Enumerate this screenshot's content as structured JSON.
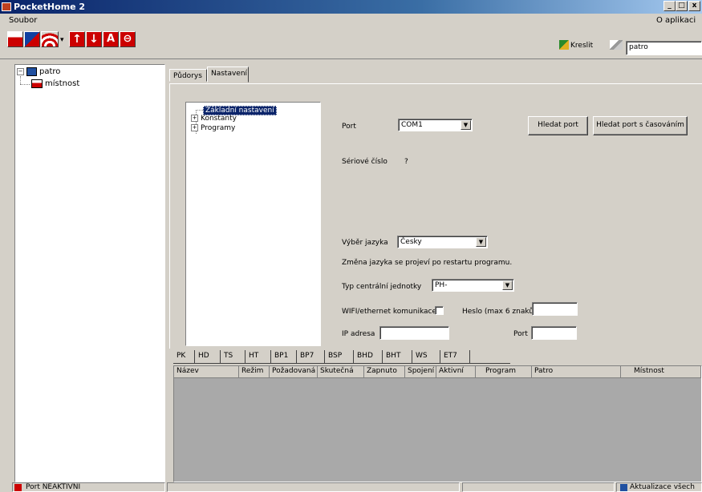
{
  "window": {
    "title": "PocketHome 2",
    "controls": [
      "_",
      "□",
      "x"
    ]
  },
  "menu": {
    "left": "Soubor",
    "right": "O aplikaci"
  },
  "toolbar": {
    "icons": [
      "save-floor-icon",
      "flags-icon",
      "wifi-icon",
      "arrow-up-icon",
      "arrow-down-icon",
      "text-icon",
      "stop-icon"
    ],
    "draw_label": "Kreslit",
    "search_value": "patro"
  },
  "left_tree": {
    "root": "patro",
    "child": "místnost"
  },
  "tabs": [
    "Půdorys",
    "Nastavení"
  ],
  "settings_tree": {
    "selected": "Základní nastavení",
    "items": [
      "Konstanty",
      "Programy"
    ]
  },
  "settings": {
    "port_label": "Port",
    "port_value": "COM1",
    "find_port": "Hledat port",
    "find_port_timed": "Hledat port s časováním",
    "serial_label": "Sériové číslo",
    "serial_value": "?",
    "language_label": "Výběr jazyka",
    "language_value": "Česky",
    "language_note": "Změna jazyka se projeví po restartu programu.",
    "unit_label": "Typ centrální jednotky",
    "unit_value": "PH-",
    "wifi_label": "WIFI/ethernet komunikace",
    "password_label": "Heslo (max 6 znaků)",
    "ip_label": "IP adresa",
    "port2_label": "Port"
  },
  "bottom_tabs": [
    "PK",
    "HD",
    "TS",
    "HT",
    "BP1",
    "BP7",
    "BSP",
    "BHD",
    "BHT",
    "WS",
    "ET7"
  ],
  "table_columns": [
    "Název",
    "Režim",
    "Požadovaná",
    "Skutečná",
    "Zapnuto",
    "Spojení",
    "Aktivní",
    "Program",
    "Patro",
    "Místnost"
  ],
  "status": {
    "left": "Port NEAKTIVNÍ",
    "right": "Aktualizace všech"
  }
}
